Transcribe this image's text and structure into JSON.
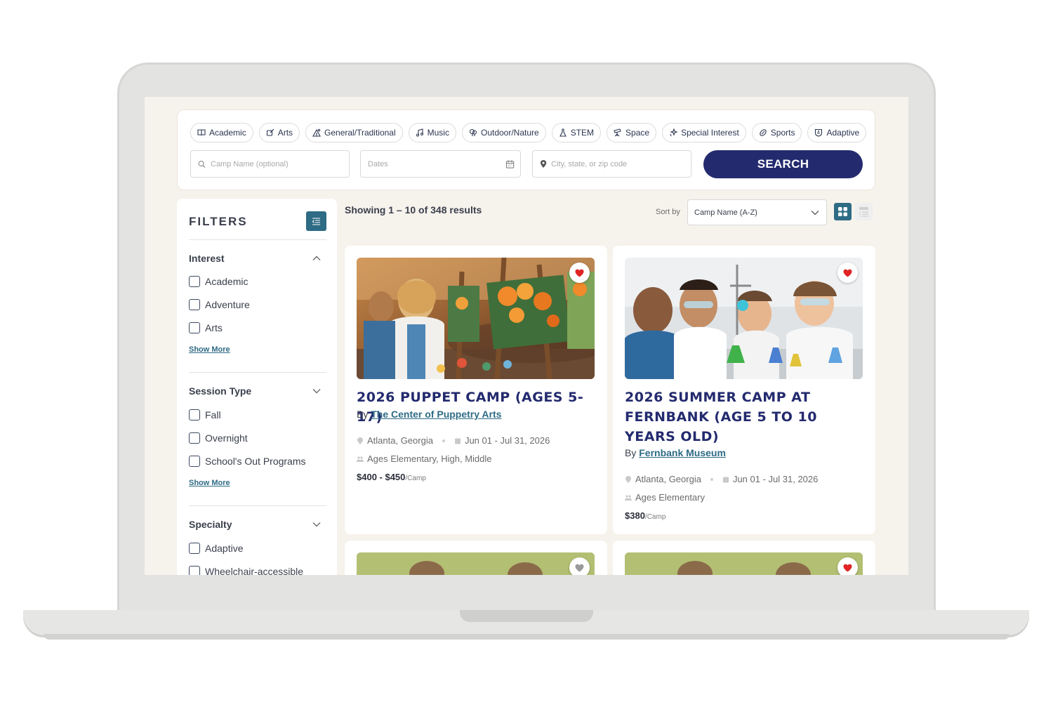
{
  "interests": [
    {
      "label": "Academic",
      "icon": "book-icon"
    },
    {
      "label": "Arts",
      "icon": "palette-icon"
    },
    {
      "label": "General/Traditional",
      "icon": "tent-icon"
    },
    {
      "label": "Music",
      "icon": "music-note-icon"
    },
    {
      "label": "Outdoor/Nature",
      "icon": "tree-icon"
    },
    {
      "label": "STEM",
      "icon": "flask-icon"
    },
    {
      "label": "Space",
      "icon": "telescope-icon"
    },
    {
      "label": "Special Interest",
      "icon": "sparkle-icon"
    },
    {
      "label": "Sports",
      "icon": "ball-icon"
    },
    {
      "label": "Adaptive",
      "icon": "accessibility-icon"
    }
  ],
  "search": {
    "name_placeholder": "Camp Name (optional)",
    "dates_placeholder": "Dates",
    "location_placeholder": "City, state, or zip code",
    "button_label": "SEARCH"
  },
  "filters": {
    "title": "FILTERS",
    "show_more": "Show More",
    "groups": [
      {
        "title": "Interest",
        "expanded": true,
        "options": [
          "Academic",
          "Adventure",
          "Arts"
        ]
      },
      {
        "title": "Session Type",
        "expanded": false,
        "options": [
          "Fall",
          "Overnight",
          "School's Out Programs"
        ]
      },
      {
        "title": "Specialty",
        "expanded": false,
        "options": [
          "Adaptive",
          "Wheelchair-accessible"
        ]
      }
    ]
  },
  "results": {
    "count_text": "Showing 1 – 10 of 348 results",
    "sort_label": "Sort by",
    "sort_value": "Camp Name (A-Z)"
  },
  "cards": [
    {
      "title": "2026 Puppet Camp (Ages 5-17)",
      "by_prefix": "By",
      "org": "The Center of Puppetry Arts",
      "location": "Atlanta, Georgia",
      "dates": "Jun 01 - Jul 31, 2026",
      "ages": "Ages Elementary, High, Middle",
      "price": "$400 - $450",
      "price_unit": "/Camp",
      "favorited": true
    },
    {
      "title": "2026 Summer Camp at Fernbank (Age 5 to 10 years old)",
      "by_prefix": "By",
      "org": "Fernbank Museum",
      "location": "Atlanta, Georgia",
      "dates": "Jun 01 - Jul 31, 2026",
      "ages": "Ages Elementary",
      "price": "$380",
      "price_unit": "/Camp",
      "favorited": true
    },
    {
      "favorited": false
    },
    {
      "favorited": true
    }
  ],
  "colors": {
    "brand_navy": "#232a6e",
    "accent_teal": "#2e6b85",
    "heart_red": "#e02424",
    "page_bg": "#f6f2ec"
  }
}
